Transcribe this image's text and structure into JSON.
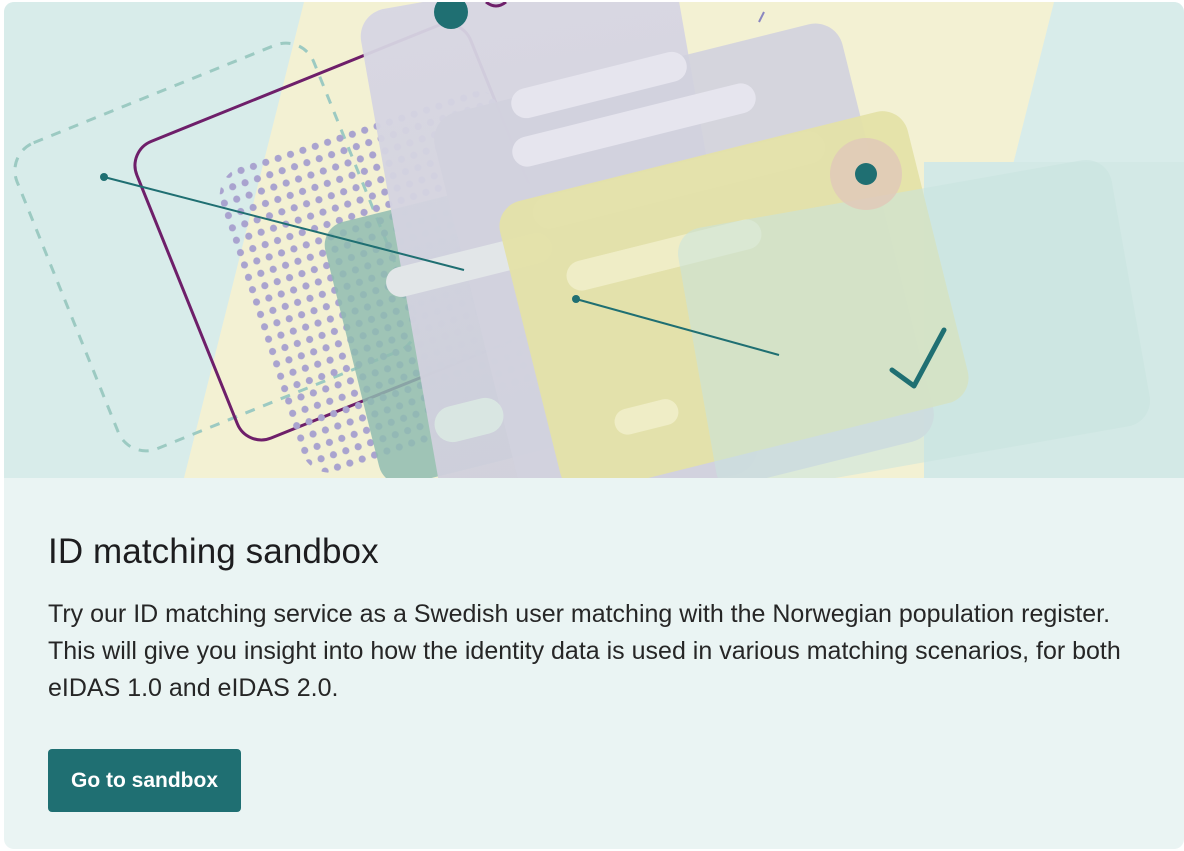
{
  "card": {
    "title": "ID matching sandbox",
    "description": "Try our ID matching service as a Swedish user matching with the Norwegian population register. This will give you insight into how the identity data is used in various matching scenarios, for both eIDAS 1.0 and eIDAS 2.0.",
    "button_label": "Go to sandbox"
  },
  "colors": {
    "card_background": "#eaf4f3",
    "button_background": "#1f6f72",
    "button_text": "#ffffff",
    "accent_teal": "#1f6f72",
    "accent_purple": "#6e1f6a",
    "hero_yellow": "#f3f1d2",
    "hero_mint": "#d3e9e6"
  }
}
